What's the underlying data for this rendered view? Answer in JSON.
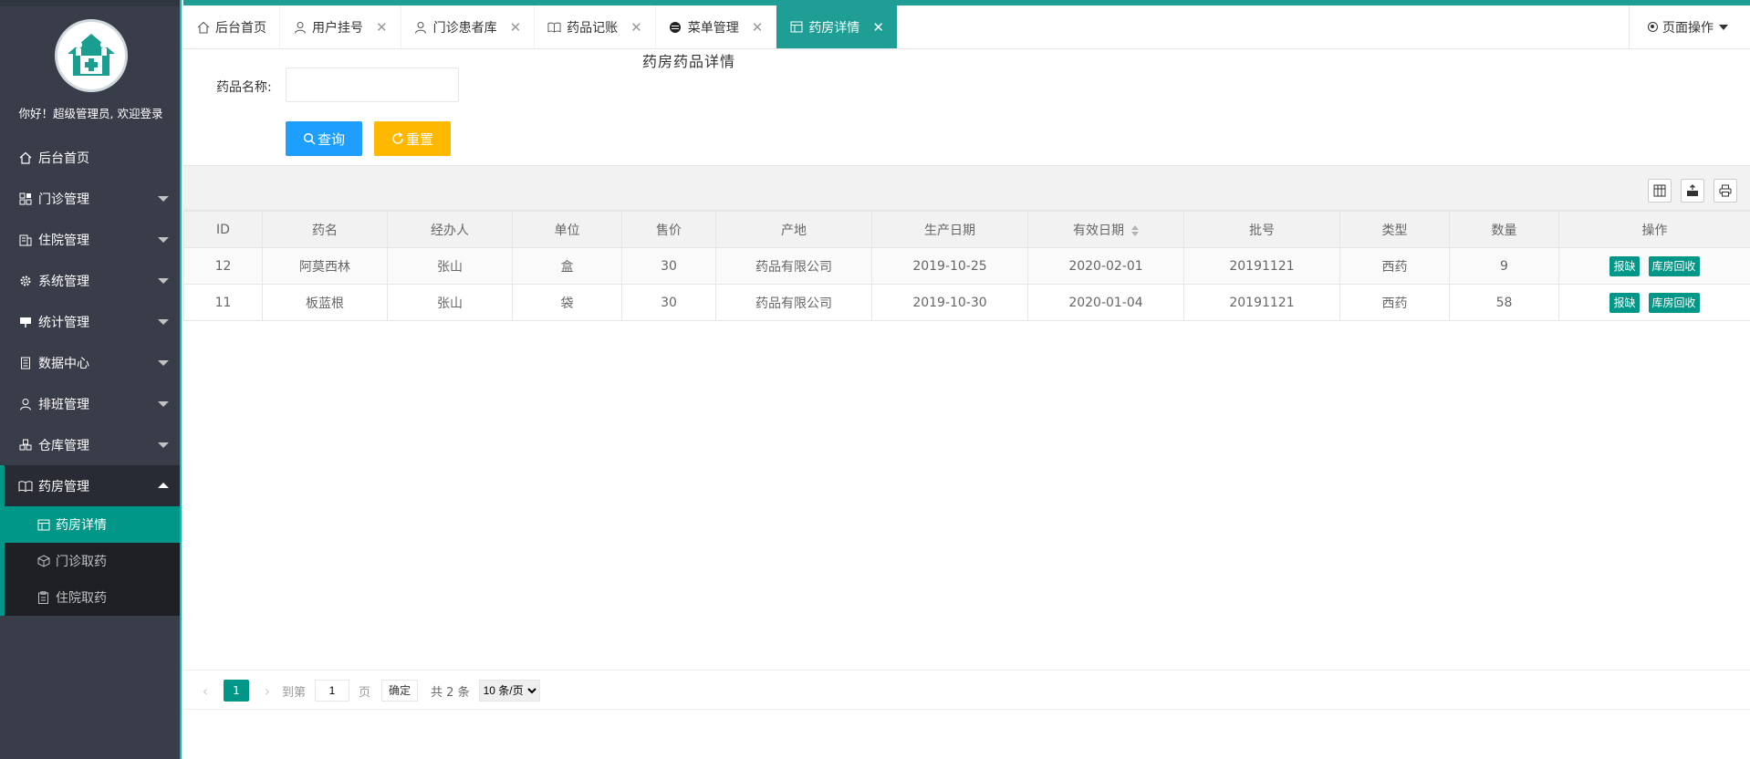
{
  "sidebar": {
    "welcome": "你好！超级管理员, 欢迎登录",
    "items": [
      {
        "label": "后台首页",
        "icon": "home-icon"
      },
      {
        "label": "门诊管理",
        "icon": "apps-icon"
      },
      {
        "label": "住院管理",
        "icon": "building-icon"
      },
      {
        "label": "系统管理",
        "icon": "gear-icon"
      },
      {
        "label": "统计管理",
        "icon": "chart-icon"
      },
      {
        "label": "数据中心",
        "icon": "document-icon"
      },
      {
        "label": "排班管理",
        "icon": "user-icon"
      },
      {
        "label": "仓库管理",
        "icon": "boxes-icon"
      },
      {
        "label": "药房管理",
        "icon": "book-icon"
      }
    ],
    "submenu": [
      {
        "label": "药房详情",
        "icon": "table-icon"
      },
      {
        "label": "门诊取药",
        "icon": "cube-icon"
      },
      {
        "label": "住院取药",
        "icon": "clipboard-icon"
      }
    ]
  },
  "tabs": [
    {
      "label": "后台首页",
      "icon": "home-icon"
    },
    {
      "label": "用户挂号",
      "icon": "user-icon"
    },
    {
      "label": "门诊患者库",
      "icon": "user-icon"
    },
    {
      "label": "药品记账",
      "icon": "book-icon"
    },
    {
      "label": "菜单管理",
      "icon": "circle-icon"
    },
    {
      "label": "药房详情",
      "icon": "table-icon"
    }
  ],
  "tab_close": "✕",
  "page_ops": "页面操作",
  "content": {
    "heading": "药房药品详情",
    "form_label": "药品名称:",
    "name_value": "",
    "query_label": "查询",
    "reset_label": "重置"
  },
  "table": {
    "headers": [
      "ID",
      "药名",
      "经办人",
      "单位",
      "售价",
      "产地",
      "生产日期",
      "有效日期",
      "批号",
      "类型",
      "数量",
      "操作"
    ],
    "rows": [
      [
        "12",
        "阿莫西林",
        "张山",
        "盒",
        "30",
        "药品有限公司",
        "2019-10-25",
        "2020-02-01",
        "20191121",
        "西药",
        "9"
      ],
      [
        "11",
        "板蓝根",
        "张山",
        "袋",
        "30",
        "药品有限公司",
        "2019-10-30",
        "2020-01-04",
        "20191121",
        "西药",
        "58"
      ]
    ],
    "op_buttons": [
      "报缺",
      "库房回收"
    ]
  },
  "pager": {
    "current": "1",
    "goto_label": "到第",
    "goto_value": "1",
    "page_label": "页",
    "confirm": "确定",
    "total": "共 2 条",
    "page_size": "10 条/页"
  },
  "colors": {
    "accent": "#009688",
    "tab_active": "#1e9e94",
    "sidebar_bg": "#393D49",
    "query_btn": "#1E9FFF",
    "reset_btn": "#FFB800"
  }
}
